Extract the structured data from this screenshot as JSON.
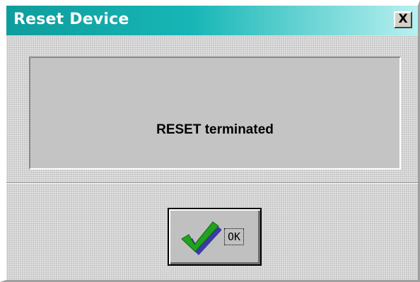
{
  "window": {
    "title": "Reset Device",
    "close_label": "X"
  },
  "message": {
    "text": "RESET terminated"
  },
  "buttons": {
    "ok_label": "OK",
    "ok_icon": "checkmark-icon"
  },
  "colors": {
    "titlebar_start": "#0f9c9c",
    "titlebar_end": "#b8f0f0",
    "check_green": "#22a21f",
    "check_shadow": "#3a3aa8"
  }
}
